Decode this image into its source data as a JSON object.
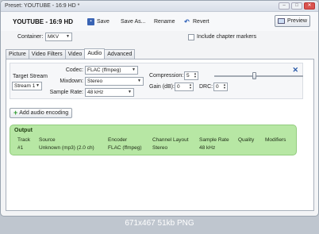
{
  "window": {
    "title": "Preset: YOUTUBE - 16:9 HD *"
  },
  "toolbar": {
    "preset_name": "YOUTUBE - 16:9 HD",
    "save_label": "Save",
    "save_as_label": "Save As...",
    "rename_label": "Rename",
    "revert_label": "Revert",
    "preview_label": "Preview"
  },
  "container": {
    "label": "Container:",
    "value": "MKV",
    "chapter_markers_label": "Include chapter markers",
    "chapter_markers_checked": false
  },
  "tabs": [
    {
      "label": "Picture",
      "active": false
    },
    {
      "label": "Video Filters",
      "active": false
    },
    {
      "label": "Video",
      "active": false
    },
    {
      "label": "Audio",
      "active": true
    },
    {
      "label": "Advanced",
      "active": false
    }
  ],
  "audio": {
    "target_stream_label": "Target Stream",
    "target_stream_value": "Stream 1",
    "codec_label": "Codec:",
    "codec_value": "FLAC (ffmpeg)",
    "mixdown_label": "Mixdown:",
    "mixdown_value": "Stereo",
    "sample_rate_label": "Sample Rate:",
    "sample_rate_value": "48 kHz",
    "compression_label": "Compression:",
    "compression_value": "5",
    "gain_label": "Gain (dB):",
    "gain_value": "0",
    "drc_label": "DRC:",
    "drc_value": "0",
    "add_button_label": "Add audio encoding"
  },
  "output": {
    "title": "Output",
    "headers": [
      "Track",
      "Source",
      "Encoder",
      "Channel Layout",
      "Sample Rate",
      "Quality",
      "Modifiers"
    ],
    "row": [
      "#1",
      "Unknown (mp3) (2.0 ch)",
      "FLAC (ffmpeg)",
      "Stereo",
      "48 kHz",
      "",
      ""
    ]
  },
  "image_caption": "671x467 51kb PNG"
}
